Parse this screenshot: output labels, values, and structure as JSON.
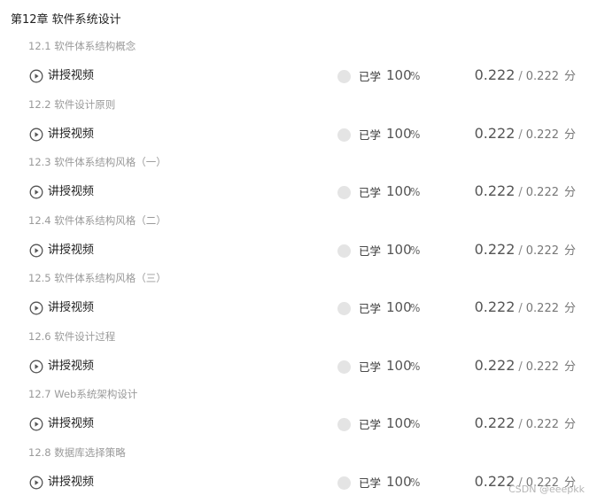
{
  "chapter": {
    "title": "第12章 软件系统设计"
  },
  "lesson_label": "讲授视频",
  "status_label": "已学",
  "progress_value": "100",
  "progress_unit": "%",
  "score_earned": "0.222",
  "score_sep": "/",
  "score_total": "0.222",
  "score_unit": "分",
  "play_icon": "play-circle-icon",
  "colors": {
    "status_dot": "#e4e4e4",
    "section_title": "#9a9a9a",
    "text": "#222222"
  },
  "sections": [
    {
      "title": "12.1 软件体系结构概念",
      "progress": 1.0
    },
    {
      "title": "12.2 软件设计原则",
      "progress": 1.0
    },
    {
      "title": "12.3 软件体系结构风格（一）",
      "progress": 1.0
    },
    {
      "title": "12.4 软件体系结构风格（二）",
      "progress": 1.0
    },
    {
      "title": "12.5 软件体系结构风格（三）",
      "progress": 1.0
    },
    {
      "title": "12.6 软件设计过程",
      "progress": 1.0
    },
    {
      "title": "12.7 Web系统架构设计",
      "progress": 1.0
    },
    {
      "title": "12.8 数据库选择策略",
      "progress": 1.0
    }
  ],
  "watermark": "CSDN @eeepkk"
}
